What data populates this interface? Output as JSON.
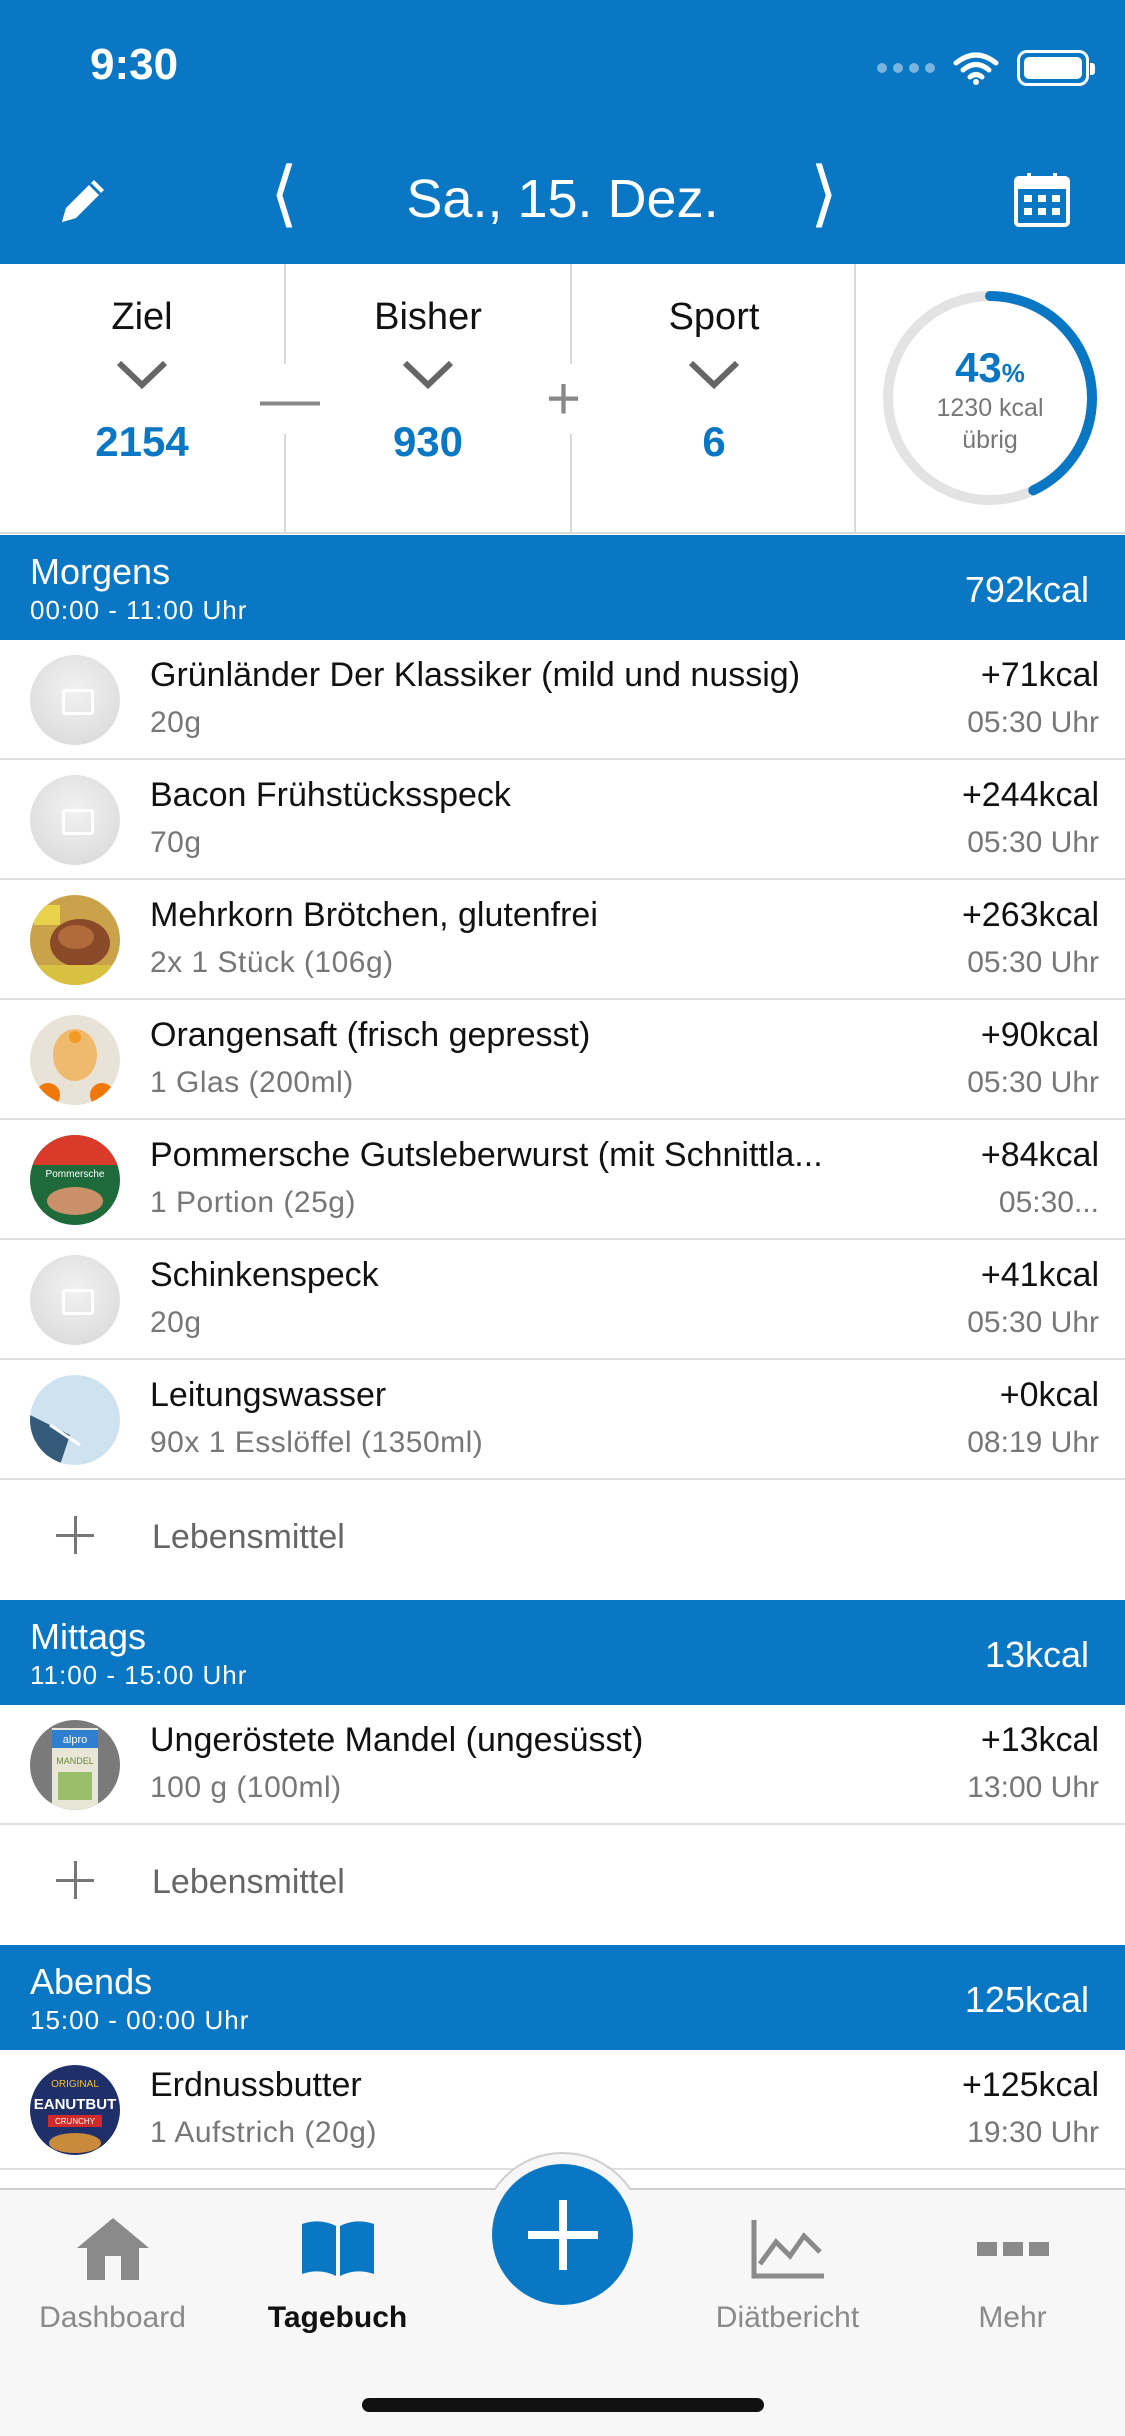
{
  "status": {
    "time": "9:30"
  },
  "header": {
    "date": "Sa., 15. Dez.",
    "prev": "⟨",
    "next": "⟩"
  },
  "summary": {
    "goal_label": "Ziel",
    "goal_value": "2154",
    "so_far_label": "Bisher",
    "so_far_value": "930",
    "sport_label": "Sport",
    "sport_value": "6",
    "minus": "—",
    "plus": "+",
    "ring_percent": "43",
    "ring_percent_sign": "%",
    "ring_fraction": 0.43,
    "ring_kcal": "1230 kcal",
    "ring_remaining": "übrig"
  },
  "meals": [
    {
      "name": "Morgens",
      "time": "00:00 - 11:00 Uhr",
      "kcal": "792kcal",
      "items": [
        {
          "title": "Grünländer Der Klassiker (mild und nussig)",
          "sub": "20g",
          "kcal": "+71kcal",
          "time": "05:30 Uhr"
        },
        {
          "title": "Bacon Frühstücksspeck",
          "sub": "70g",
          "kcal": "+244kcal",
          "time": "05:30 Uhr"
        },
        {
          "title": "Mehrkorn Brötchen, glutenfrei",
          "sub": "2x 1 Stück (106g)",
          "kcal": "+263kcal",
          "time": "05:30 Uhr"
        },
        {
          "title": "Orangensaft (frisch gepresst)",
          "sub": "1 Glas (200ml)",
          "kcal": "+90kcal",
          "time": "05:30 Uhr"
        },
        {
          "title": "Pommersche Gutsleberwurst (mit Schnittla...",
          "sub": "1 Portion (25g)",
          "kcal": "+84kcal",
          "time": "05:30..."
        },
        {
          "title": "Schinkenspeck",
          "sub": "20g",
          "kcal": "+41kcal",
          "time": "05:30 Uhr"
        },
        {
          "title": "Leitungswasser",
          "sub": "90x 1 Esslöffel (1350ml)",
          "kcal": "+0kcal",
          "time": "08:19 Uhr"
        }
      ],
      "add_label": "Lebensmittel"
    },
    {
      "name": "Mittags",
      "time": "11:00 - 15:00 Uhr",
      "kcal": "13kcal",
      "items": [
        {
          "title": "Ungeröstete Mandel (ungesüsst)",
          "sub": "100 g (100ml)",
          "kcal": "+13kcal",
          "time": "13:00 Uhr"
        }
      ],
      "add_label": "Lebensmittel"
    },
    {
      "name": "Abends",
      "time": "15:00 - 00:00 Uhr",
      "kcal": "125kcal",
      "items": [
        {
          "title": "Erdnussbutter",
          "sub": "1 Aufstrich (20g)",
          "kcal": "+125kcal",
          "time": "19:30 Uhr"
        }
      ]
    }
  ],
  "thumb_labels": {
    "pommersche": "Pommersche",
    "alpro": "alpro",
    "alpro_sub": "MANDEL",
    "peanut_top": "ORIGINAL",
    "peanut_mid": "EANUTBUT",
    "peanut_bot": "CRUNCHY"
  },
  "tabs": [
    {
      "label": "Dashboard",
      "icon": "home-icon"
    },
    {
      "label": "Tagebuch",
      "icon": "book-icon"
    },
    {
      "label": "Diätbericht",
      "icon": "chart-icon"
    },
    {
      "label": "Mehr",
      "icon": "more-icon"
    }
  ],
  "colors": {
    "accent": "#0a77c4"
  }
}
